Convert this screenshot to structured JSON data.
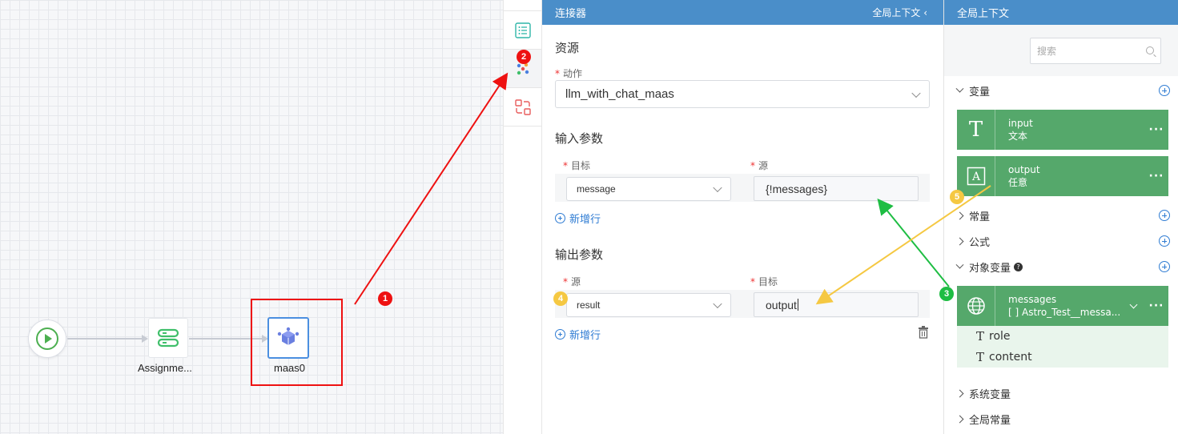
{
  "canvas": {
    "nodes": [
      {
        "label": ""
      },
      {
        "label": "Assignme..."
      },
      {
        "label": "maas0"
      }
    ],
    "annotations": {
      "badge1": "1",
      "badge2": "2",
      "badge3": "3",
      "badge4": "4",
      "badge5": "5"
    }
  },
  "connector": {
    "title": "连接器",
    "context_toggle": "全局上下文 ‹",
    "resource_section": "资源",
    "action_label": "动作",
    "action_value": "llm_with_chat_maas",
    "input_section": "输入参数",
    "input_headers": {
      "target": "目标",
      "source": "源"
    },
    "input_row": {
      "target": "message",
      "source": "{!messages}"
    },
    "add_row_label": "新增行",
    "output_section": "输出参数",
    "output_headers": {
      "source": "源",
      "target": "目标"
    },
    "output_row": {
      "source": "result",
      "target": "output"
    }
  },
  "context": {
    "title": "全局上下文",
    "search_placeholder": "搜索",
    "groups": {
      "variables": "变量",
      "constants": "常量",
      "formulas": "公式",
      "object_variables": "对象变量",
      "system_variables": "系统变量",
      "global_constants": "全局常量"
    },
    "variables": [
      {
        "name": "input",
        "type": "文本",
        "icon": "text-icon"
      },
      {
        "name": "output",
        "type": "任意",
        "icon": "any-icon"
      }
    ],
    "object_variable": {
      "name": "messages",
      "type": "[ ] Astro_Test__messa...",
      "icon": "globe-icon"
    },
    "object_fields": [
      {
        "name": "role"
      },
      {
        "name": "content"
      }
    ]
  }
}
